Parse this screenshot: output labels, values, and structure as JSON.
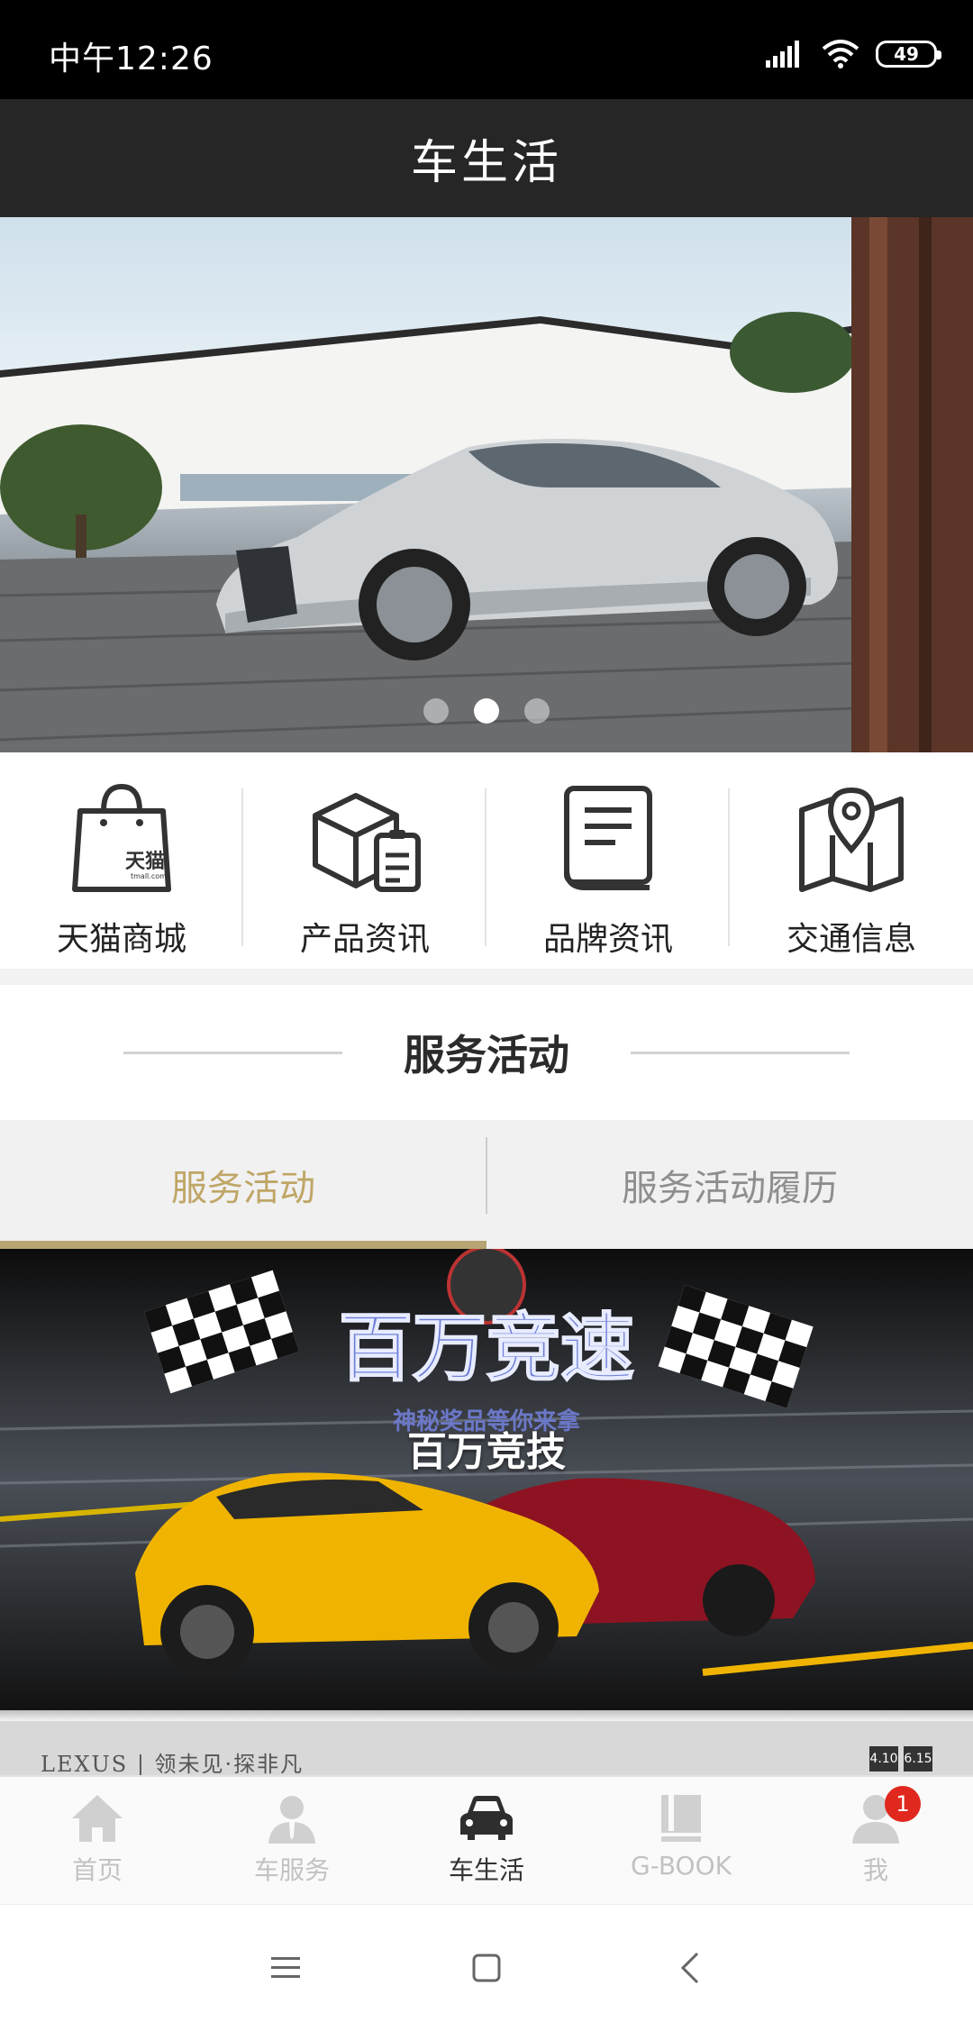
{
  "status_bar": {
    "time": "中午12:26",
    "battery": "49"
  },
  "header": {
    "title": "车生活"
  },
  "banner": {
    "slide_count": 3,
    "active_slide": 2
  },
  "quick_menu": [
    {
      "label": "天猫商城",
      "icon": "shopping-bag-icon",
      "icon_text": "天猫",
      "icon_subtext": "tmall.com"
    },
    {
      "label": "产品资讯",
      "icon": "package-icon"
    },
    {
      "label": "品牌资讯",
      "icon": "book-icon"
    },
    {
      "label": "交通信息",
      "icon": "map-pin-icon"
    }
  ],
  "section": {
    "title": "服务活动"
  },
  "tabs": [
    {
      "label": "服务活动",
      "active": true
    },
    {
      "label": "服务活动履历",
      "active": false
    }
  ],
  "activity": {
    "title": "百万竞技",
    "poster_headline": "百万竞速",
    "poster_subtitle": "神秘奖品等你来拿"
  },
  "next_card": {
    "text": "LEXUS | 领未见·探非凡",
    "badges": [
      "4.10",
      "6.15"
    ]
  },
  "bottom_nav": [
    {
      "label": "首页",
      "icon": "home-icon",
      "active": false
    },
    {
      "label": "车服务",
      "icon": "service-person-icon",
      "active": false
    },
    {
      "label": "车生活",
      "icon": "car-icon",
      "active": true
    },
    {
      "label": "G-BOOK",
      "icon": "gbook-icon",
      "active": false
    },
    {
      "label": "我",
      "icon": "profile-icon",
      "active": false,
      "badge": "1"
    }
  ],
  "colors": {
    "header_bg": "#262626",
    "accent_gold": "#bfa666",
    "badge_red": "#e0281f"
  }
}
